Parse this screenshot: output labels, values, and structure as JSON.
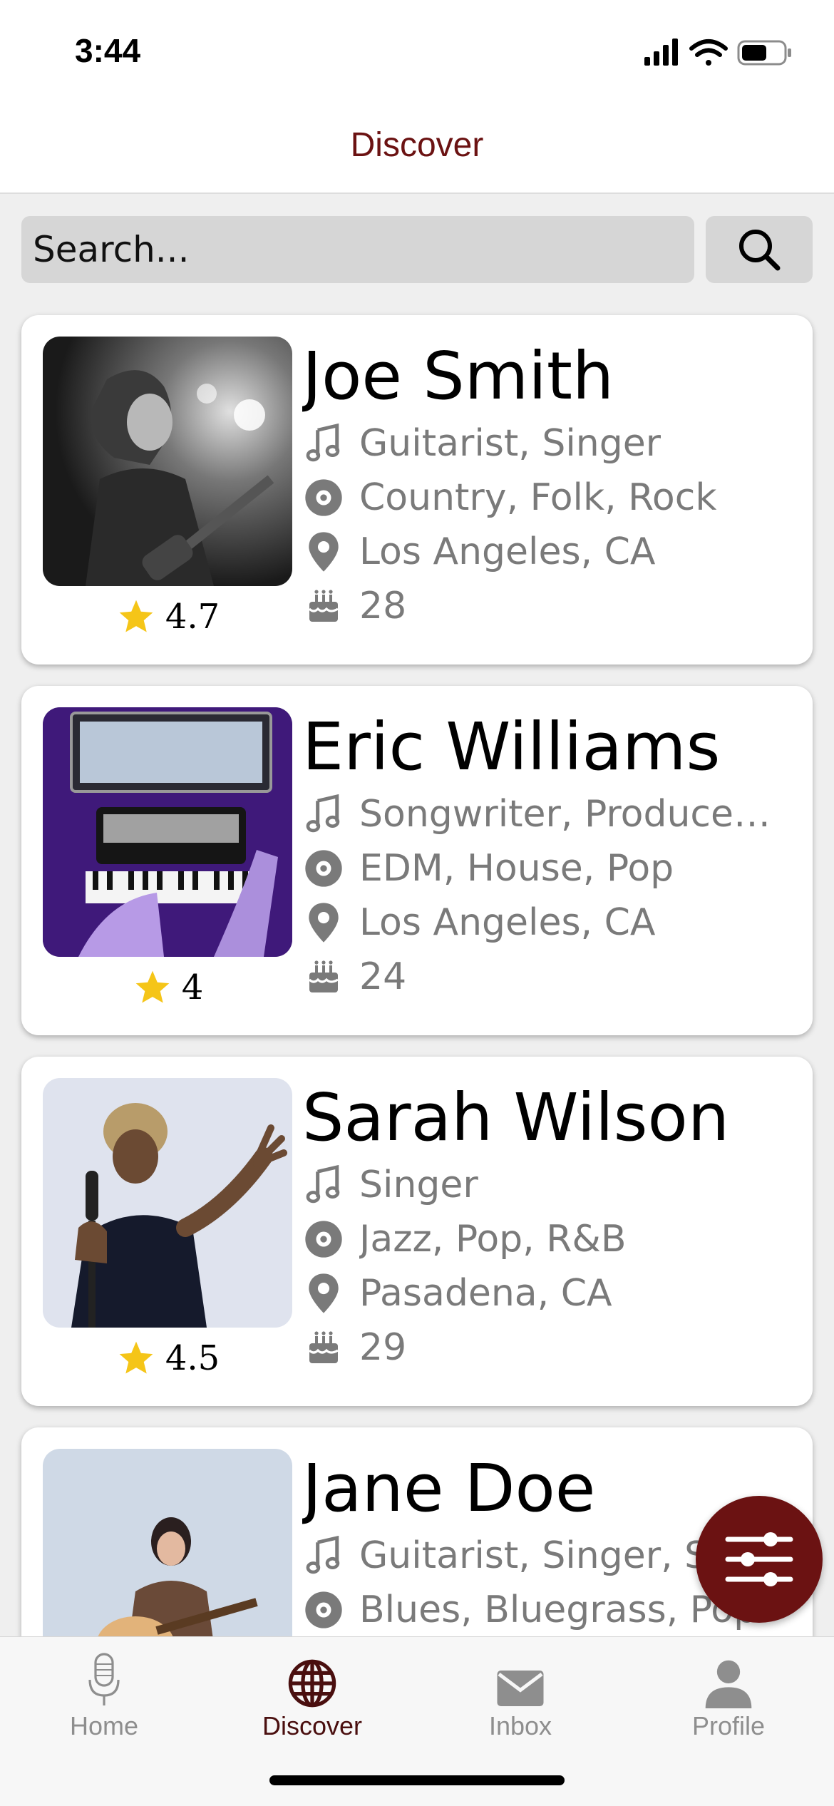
{
  "status_bar": {
    "time": "3:44"
  },
  "header": {
    "title": "Discover"
  },
  "search": {
    "placeholder": "Search..."
  },
  "musicians": [
    {
      "name": "Joe Smith",
      "roles": "Guitarist, Singer",
      "genres": "Country, Folk, Rock",
      "location": "Los Angeles, CA",
      "age": "28",
      "rating": "4.7"
    },
    {
      "name": "Eric Williams",
      "roles": "Songwriter, Producer,...",
      "genres": "EDM, House, Pop",
      "location": "Los Angeles, CA",
      "age": "24",
      "rating": "4"
    },
    {
      "name": "Sarah Wilson",
      "roles": "Singer",
      "genres": "Jazz, Pop, R&B",
      "location": "Pasadena, CA",
      "age": "29",
      "rating": "4.5"
    },
    {
      "name": "Jane Doe",
      "roles": "Guitarist, Singer, So",
      "genres": "Blues, Bluegrass, Pop"
    }
  ],
  "tabs": [
    {
      "label": "Home",
      "icon": "microphone-icon"
    },
    {
      "label": "Discover",
      "icon": "globe-icon",
      "active": true
    },
    {
      "label": "Inbox",
      "icon": "mail-icon"
    },
    {
      "label": "Profile",
      "icon": "person-icon"
    }
  ],
  "colors": {
    "accent": "#6b1212",
    "star": "#f5c518",
    "info_text": "#7a7a7a"
  }
}
